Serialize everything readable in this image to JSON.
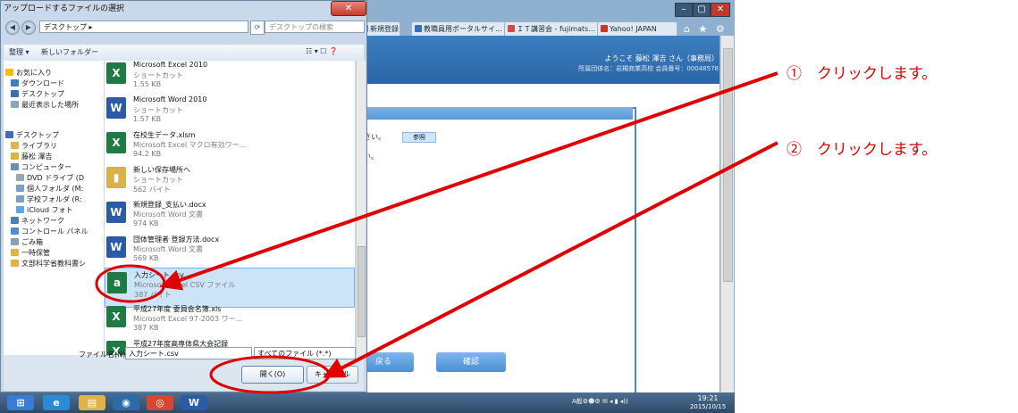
{
  "browser": {
    "tabs": [
      {
        "label": "新規登録",
        "color": "#3b8ad8"
      },
      {
        "label": "教職員用ポータルサイ...",
        "color": "#2f72b5"
      },
      {
        "label": "ＩＴ講習会 - fujimats...",
        "color": "#d44a4a"
      },
      {
        "label": "Yahoo! JAPAN",
        "color": "#c0392b"
      }
    ],
    "window_controls": [
      "–",
      "▢",
      "✕"
    ],
    "toolbar_icons": "⌂ ★ ⚙",
    "welcome": "ようこそ 藤松 澤吉 さん（事務局）",
    "org_line": "所属団体名：岩槻商業高校  会員番号：00048578",
    "instruction": "さい。",
    "instruction_tail": "い。",
    "file_button": "参照",
    "back_button": "戻る",
    "confirm_button": "確認"
  },
  "dialog": {
    "title": "アップロードするファイルの選択",
    "close": "✕",
    "address": "デスクトップ ▸",
    "search_placeholder": "デスクトップの検索",
    "toolbar": {
      "organize": "整理 ▾",
      "new_folder": "新しいフォルダー",
      "view": "☷ ▾  ☐  ❓"
    },
    "nav_items": [
      {
        "label": "お気に入り",
        "color": "#f2c200"
      },
      {
        "label": "ダウンロード",
        "color": "#3d7fc4"
      },
      {
        "label": "デスクトップ",
        "color": "#3d6fb0"
      },
      {
        "label": "最近表示した場所",
        "color": "#8aa5c4"
      },
      {
        "label": "デスクトップ",
        "color": "#3d6fb0"
      },
      {
        "label": "ライブラリ",
        "color": "#e0b24a"
      },
      {
        "label": "藤松  澤吉",
        "color": "#e0b24a"
      },
      {
        "label": "コンピューター",
        "color": "#6a8fb8"
      },
      {
        "label": "DVD ドライブ (D",
        "color": "#9aa7b5"
      },
      {
        "label": "個人フォルダ (M:",
        "color": "#7aa0c8"
      },
      {
        "label": "学校フォルダ (R:",
        "color": "#7aa0c8"
      },
      {
        "label": "iCloud フォト",
        "color": "#5aa8e6"
      },
      {
        "label": "ネットワーク",
        "color": "#4d7fb6"
      },
      {
        "label": "コントロール パネル",
        "color": "#4e8fc9"
      },
      {
        "label": "ごみ箱",
        "color": "#8aa0b5"
      },
      {
        "label": "一時保管",
        "color": "#e0b24a"
      },
      {
        "label": "文部科学省教科書シ",
        "color": "#e0b24a"
      }
    ],
    "files": [
      {
        "name": "Microsoft Excel 2010",
        "type": "ショートカット",
        "size": "1.55 KB",
        "icon": "X",
        "color": "#1f7a43"
      },
      {
        "name": "Microsoft Word 2010",
        "type": "ショートカット",
        "size": "1.57 KB",
        "icon": "W",
        "color": "#2b5aa8"
      },
      {
        "name": "在校生データ.xlsm",
        "type": "Microsoft Excel マクロ有効ワー...",
        "size": "94.2 KB",
        "icon": "X",
        "color": "#1f7a43"
      },
      {
        "name": "新しい保存場所へ",
        "type": "ショートカット",
        "size": "562 バイト",
        "icon": "▮",
        "color": "#d9b04a"
      },
      {
        "name": "新規登録_支払い.docx",
        "type": "Microsoft Word 文書",
        "size": "974 KB",
        "icon": "W",
        "color": "#2b5aa8"
      },
      {
        "name": "団体管理者  登録方法.docx",
        "type": "Microsoft Word 文書",
        "size": "569 KB",
        "icon": "W",
        "color": "#2b5aa8"
      },
      {
        "name": "入力シート.csv",
        "type": "Microsoft Excel CSV ファイル",
        "size": "387 バイト",
        "icon": "a",
        "color": "#1f7a43"
      },
      {
        "name": "平成27年度 委員会名簿.xls",
        "type": "Microsoft Excel 97-2003 ワー...",
        "size": "387 KB",
        "icon": "X",
        "color": "#1f7a43"
      },
      {
        "name": "平成27年度高専体県大会記録",
        "type": "",
        "size": "",
        "icon": "X",
        "color": "#1f7a43"
      }
    ],
    "filename_label": "ファイル名(N):",
    "filename_value": "入力シート.csv",
    "filetype_value": "すべてのファイル (*.*)",
    "open_button": "開く(O)",
    "cancel_button": "キャンセル"
  },
  "taskbar": {
    "apps": [
      {
        "icon": "⊞",
        "color": "#3a7bd5"
      },
      {
        "icon": "e",
        "color": "#2a8ad8"
      },
      {
        "icon": "▤",
        "color": "#e0b24a"
      },
      {
        "icon": "◉",
        "color": "#2c6aa8"
      },
      {
        "icon": "◎",
        "color": "#d9462f"
      },
      {
        "icon": "W",
        "color": "#2b5aa8"
      }
    ],
    "tray": "A般⚙☻⚙ ✉ ◂ ▮ ◂))",
    "time": "19:21",
    "date": "2015/10/15"
  },
  "annotations": {
    "step1": "①　クリックします。",
    "step2": "②　クリックします。"
  }
}
